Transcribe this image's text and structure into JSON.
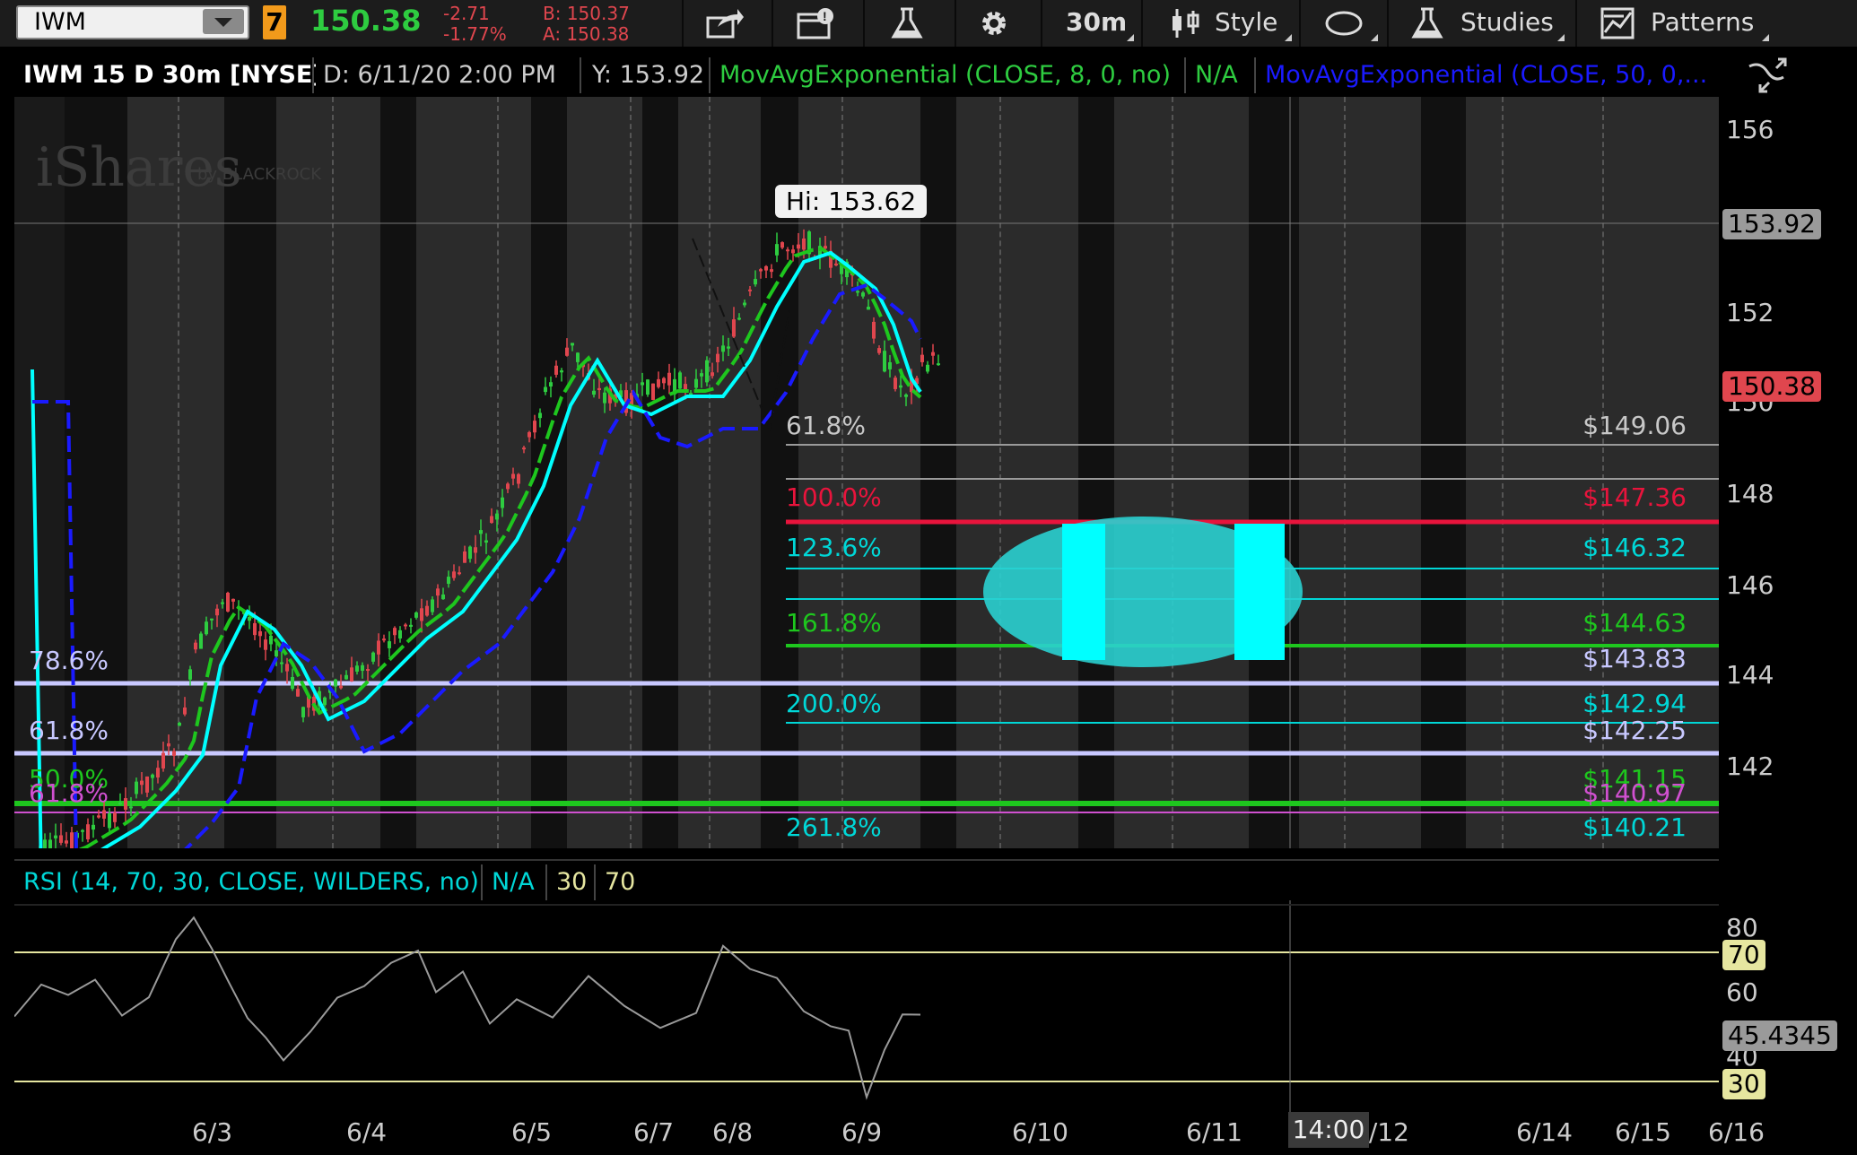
{
  "toolbar": {
    "symbol": "IWM",
    "link_badge": "7",
    "last_price": "150.38",
    "net_change": "-2.71",
    "pct_change": "-1.77%",
    "bid": "B: 150.37",
    "ask": "A: 150.38",
    "timeframe": "30m",
    "style_label": "Style",
    "studies_label": "Studies",
    "patterns_label": "Patterns",
    "icons": [
      "share-icon",
      "active-trader-icon",
      "flask-icon",
      "gear-icon",
      "candle-style-icon",
      "ellipse-drawing-icon",
      "studies-flask-icon",
      "patterns-icon"
    ]
  },
  "header": {
    "title": "IWM 15 D 30m [NYSE]",
    "date": "D: 6/11/20 2:00 PM",
    "y_value": "Y: 153.92",
    "ema8": "MovAvgExponential (CLOSE, 8, 0, no)",
    "ema8_value": "N/A",
    "ema50": "MovAvgExponential (CLOSE, 50, 0,..."
  },
  "watermark": {
    "brand": "iShares",
    "sub": "by BLACKROCK"
  },
  "price_axis": {
    "ticks": [
      "156",
      "152",
      "150",
      "148",
      "146",
      "144",
      "142"
    ],
    "cursor_tag": "153.92",
    "last_tag": "150.38"
  },
  "hi_callout": "Hi: 153.62",
  "fib_right": {
    "ratio_labels": [
      "61.8%",
      "100.0%",
      "123.6%",
      "161.8%",
      "200.0%",
      "261.8%"
    ],
    "price_labels": [
      "$149.06",
      "$147.36",
      "$146.32",
      "$144.63",
      "$143.83",
      "$142.94",
      "$142.25",
      "$141.15",
      "$140.97",
      "$140.21"
    ]
  },
  "fib_left": {
    "labels": [
      "78.6%",
      "61.8%",
      "50.0%",
      "61.8%"
    ]
  },
  "rsi": {
    "title": "RSI (14, 70, 30, CLOSE, WILDERS, no)",
    "value_na": "N/A",
    "over_sold": "30",
    "over_bought": "70",
    "axis_ticks": [
      "80",
      "60",
      "40"
    ],
    "tag_70": "70",
    "tag_30": "30",
    "current_tag": "45.4345"
  },
  "x_axis": {
    "labels": [
      "6/3",
      "6/4",
      "6/5",
      "6/7",
      "6/8",
      "6/9",
      "6/10",
      "6/11",
      "6/12",
      "6/14",
      "6/15",
      "6/16"
    ],
    "cursor_time": "14:00"
  },
  "colors": {
    "up": "#2ecc40",
    "down": "#e0464e",
    "ema8": "#00ffff",
    "ema50": "#1a1aff",
    "fib_green": "#1ec71e",
    "fib_cyan": "#00d7d7",
    "fib_red": "#e8143c",
    "fib_lavender": "#c8c8ff",
    "fib_magenta": "#d050d0",
    "rsi_line": "#9a9a9a",
    "rsi_level": "#e6e6a0"
  }
}
